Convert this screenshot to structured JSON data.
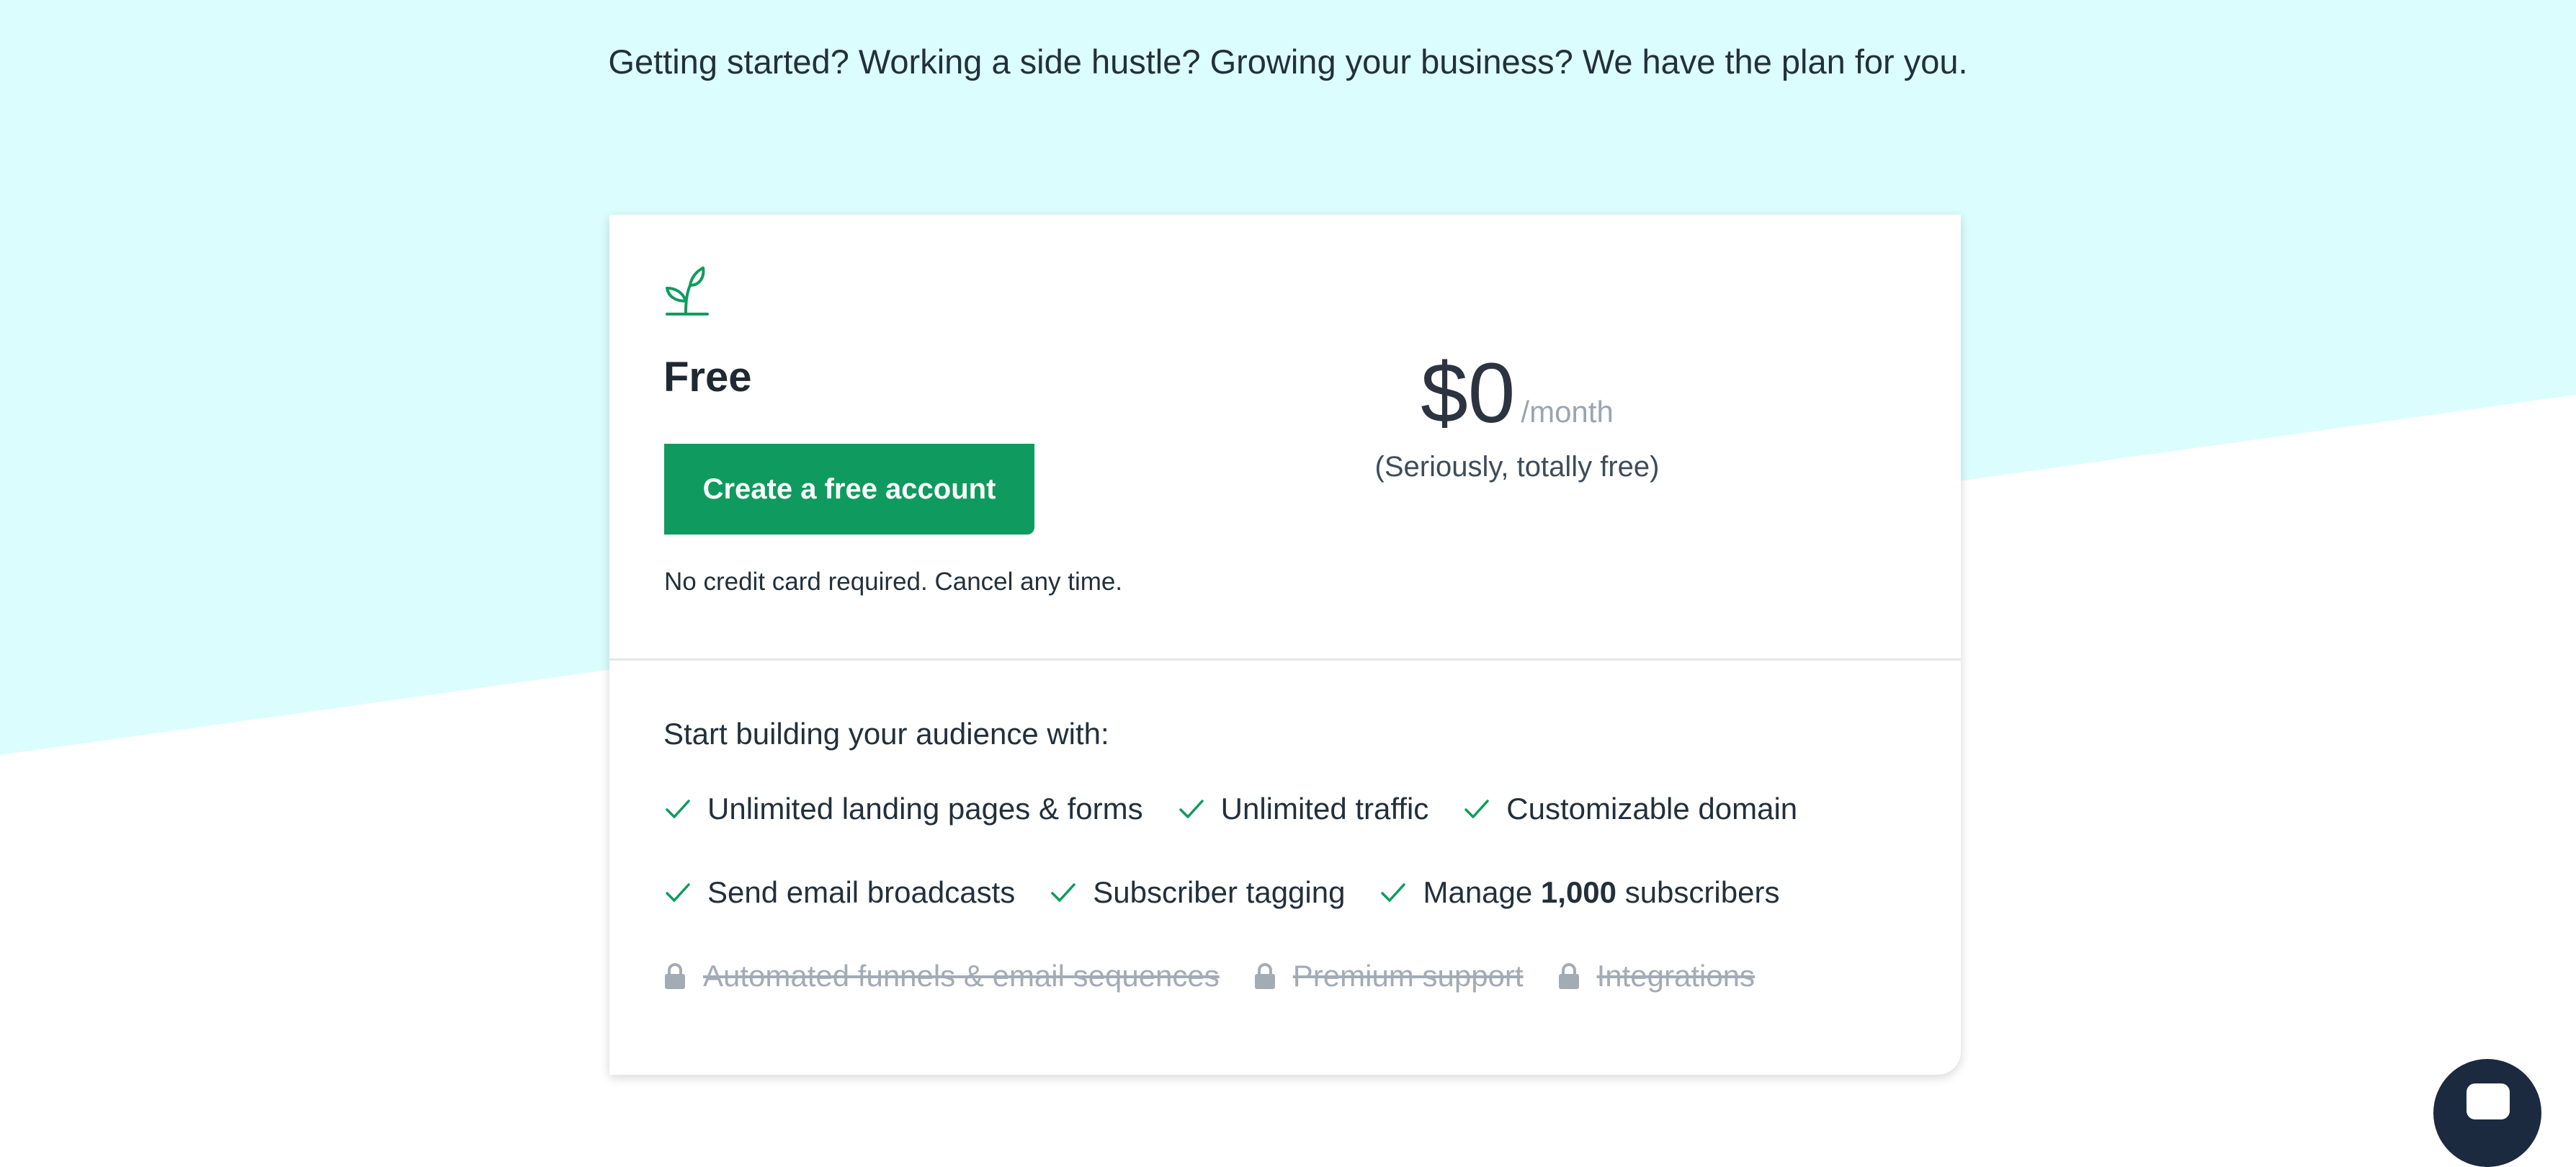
{
  "page": {
    "subtitle": "Getting started? Working a side hustle? Growing your business? We have the plan for you."
  },
  "plan": {
    "icon": "seedling-icon",
    "name": "Free",
    "cta_label": "Create a free account",
    "cta_note": "No credit card required. Cancel any time.",
    "price": "$0",
    "period": "/month",
    "price_note": "(Seriously, totally free)"
  },
  "features": {
    "heading": "Start building your audience with:",
    "row1": [
      {
        "label": "Unlimited landing pages & forms",
        "icon": "check-icon"
      },
      {
        "label": "Unlimited traffic",
        "icon": "check-icon"
      },
      {
        "label": "Customizable domain",
        "icon": "check-icon"
      }
    ],
    "row2": [
      {
        "label": "Send email broadcasts",
        "icon": "check-icon"
      },
      {
        "label": "Subscriber tagging",
        "icon": "check-icon"
      },
      {
        "prefix": "Manage ",
        "bold": "1,000",
        "suffix": " subscribers",
        "icon": "check-icon"
      }
    ],
    "locked": [
      {
        "label": "Automated funnels & email sequences",
        "icon": "lock-icon"
      },
      {
        "label": "Premium support",
        "icon": "lock-icon"
      },
      {
        "label": "Integrations",
        "icon": "lock-icon"
      }
    ]
  },
  "chat": {
    "icon": "chat-bubble-icon"
  },
  "colors": {
    "background_accent": "#dcfdfe",
    "brand_green": "#0f9b5f",
    "text_dark": "#1f2933",
    "muted": "#9aa5b1",
    "chat_launcher": "#1b2a3f"
  }
}
